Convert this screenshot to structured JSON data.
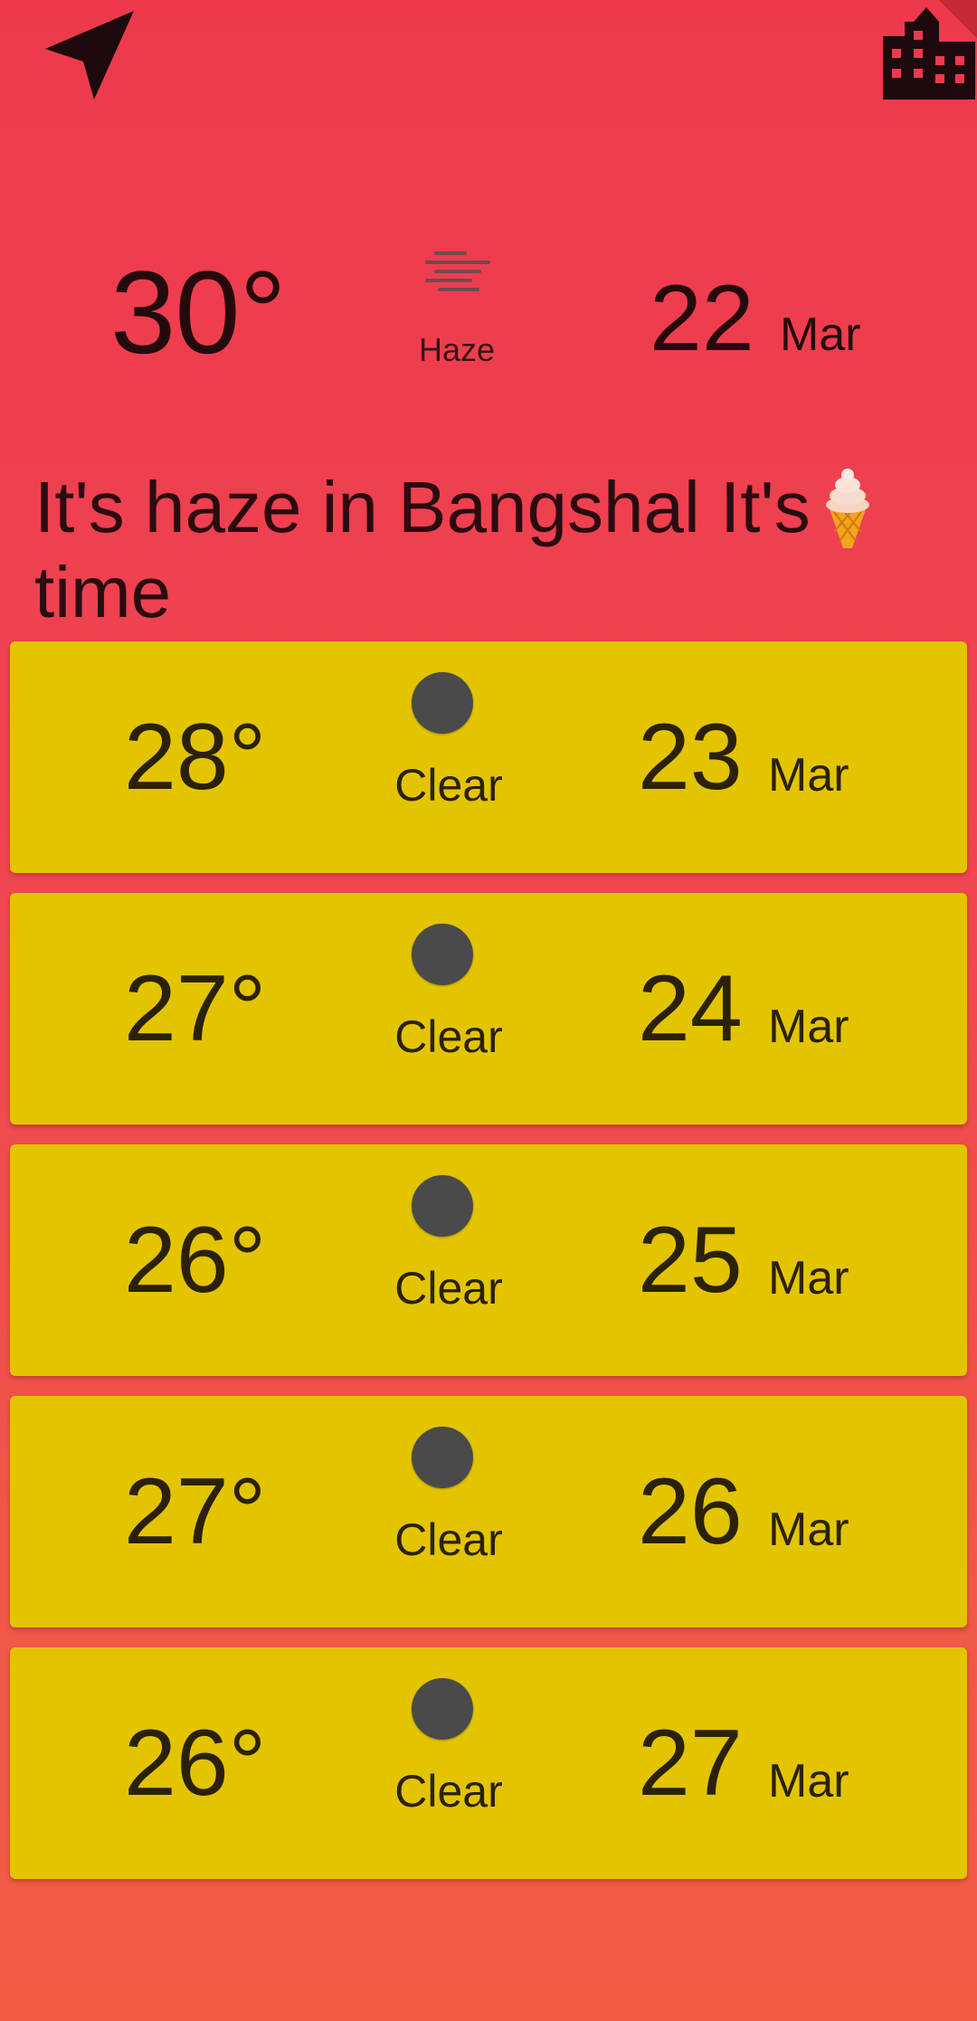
{
  "header": {
    "left_icon": "navigation-arrow-icon",
    "right_icon": "city-buildings-icon"
  },
  "current": {
    "temperature": "30°",
    "condition": "Haze",
    "condition_icon": "haze-icon",
    "day": "22",
    "month": "Mar"
  },
  "message": {
    "text": "It's haze in Bangshal It's time",
    "emoji": "ice-cream-icon"
  },
  "forecast": [
    {
      "temperature": "28°",
      "condition": "Clear",
      "icon": "clear-icon",
      "day": "23",
      "month": "Mar"
    },
    {
      "temperature": "27°",
      "condition": "Clear",
      "icon": "clear-icon",
      "day": "24",
      "month": "Mar"
    },
    {
      "temperature": "26°",
      "condition": "Clear",
      "icon": "clear-icon",
      "day": "25",
      "month": "Mar"
    },
    {
      "temperature": "27°",
      "condition": "Clear",
      "icon": "clear-icon",
      "day": "26",
      "month": "Mar"
    },
    {
      "temperature": "26°",
      "condition": "Clear",
      "icon": "clear-icon",
      "day": "27",
      "month": "Mar"
    }
  ],
  "colors": {
    "background_top": "#ee394d",
    "background_bottom": "#f35b45",
    "card": "#e3c400",
    "icon_dark": "#1e0a0c"
  }
}
